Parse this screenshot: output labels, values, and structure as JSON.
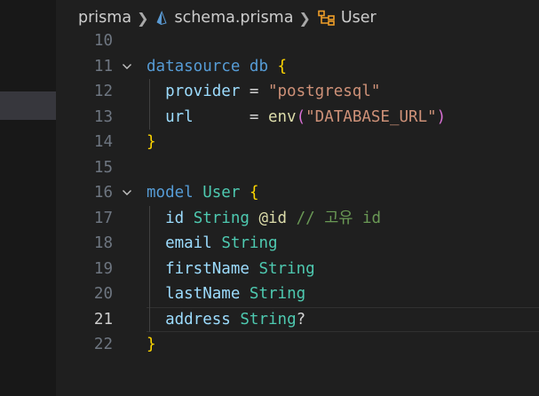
{
  "breadcrumb": {
    "folder": "prisma",
    "file": "schema.prisma",
    "symbol": "User"
  },
  "colors": {
    "keyword": "#569cd6",
    "type": "#4ec9b0",
    "property": "#9cdcfe",
    "string": "#ce9178",
    "function": "#dcdcaa",
    "bracket": "#ffd700",
    "comment": "#6a9955"
  },
  "active_line": "21",
  "lines": [
    {
      "num": "10",
      "tokens": []
    },
    {
      "num": "11",
      "fold": true,
      "tokens": [
        {
          "t": "datasource",
          "c": "kw"
        },
        {
          "t": " "
        },
        {
          "t": "db",
          "c": "kw"
        },
        {
          "t": " "
        },
        {
          "t": "{",
          "c": "br"
        }
      ]
    },
    {
      "num": "12",
      "tokens": [
        {
          "t": "  "
        },
        {
          "t": "provider",
          "c": "id"
        },
        {
          "t": " = ",
          "c": "op"
        },
        {
          "t": "\"postgresql\"",
          "c": "str"
        }
      ]
    },
    {
      "num": "13",
      "tokens": [
        {
          "t": "  "
        },
        {
          "t": "url",
          "c": "id"
        },
        {
          "t": "      = ",
          "c": "op"
        },
        {
          "t": "env",
          "c": "fn"
        },
        {
          "t": "(",
          "c": "br2"
        },
        {
          "t": "\"DATABASE_URL\"",
          "c": "str"
        },
        {
          "t": ")",
          "c": "br2"
        }
      ]
    },
    {
      "num": "14",
      "tokens": [
        {
          "t": "}",
          "c": "br"
        }
      ]
    },
    {
      "num": "15",
      "tokens": []
    },
    {
      "num": "16",
      "fold": true,
      "tokens": [
        {
          "t": "model",
          "c": "kw"
        },
        {
          "t": " "
        },
        {
          "t": "User",
          "c": "ty"
        },
        {
          "t": " "
        },
        {
          "t": "{",
          "c": "br"
        }
      ]
    },
    {
      "num": "17",
      "tokens": [
        {
          "t": "  "
        },
        {
          "t": "id",
          "c": "id"
        },
        {
          "t": " "
        },
        {
          "t": "String",
          "c": "ty"
        },
        {
          "t": " "
        },
        {
          "t": "@id",
          "c": "at"
        },
        {
          "t": " "
        },
        {
          "t": "// 고유 id",
          "c": "cm"
        }
      ]
    },
    {
      "num": "18",
      "tokens": [
        {
          "t": "  "
        },
        {
          "t": "email",
          "c": "id"
        },
        {
          "t": " "
        },
        {
          "t": "String",
          "c": "ty"
        }
      ]
    },
    {
      "num": "19",
      "tokens": [
        {
          "t": "  "
        },
        {
          "t": "firstName",
          "c": "id"
        },
        {
          "t": " "
        },
        {
          "t": "String",
          "c": "ty"
        }
      ]
    },
    {
      "num": "20",
      "tokens": [
        {
          "t": "  "
        },
        {
          "t": "lastName",
          "c": "id"
        },
        {
          "t": " "
        },
        {
          "t": "String",
          "c": "ty"
        }
      ]
    },
    {
      "num": "21",
      "tokens": [
        {
          "t": "  "
        },
        {
          "t": "address",
          "c": "id"
        },
        {
          "t": " "
        },
        {
          "t": "String",
          "c": "ty"
        },
        {
          "t": "?",
          "c": "op"
        }
      ]
    },
    {
      "num": "22",
      "tokens": [
        {
          "t": "}",
          "c": "br"
        }
      ]
    }
  ]
}
